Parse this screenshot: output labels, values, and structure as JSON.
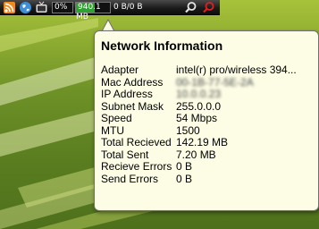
{
  "toolbar": {
    "cpu_percent_label": "0%",
    "cpu_usage_percent": 0,
    "memory_label": "940.1 MB",
    "memory_usage_percent": 55,
    "network_label": "0 B/0 B",
    "icons": [
      "rss-icon",
      "globe-icon",
      "tv-icon",
      "search-icon",
      "search-red-icon"
    ],
    "meter_fill_color": "#2fa32f"
  },
  "flyout": {
    "title": "Network Information",
    "rows": [
      {
        "label": "Adapter",
        "value": "intel(r) pro/wireless 394..."
      },
      {
        "label": "Mac Address",
        "value": "00-1B-77-5E-2A",
        "obscured": true
      },
      {
        "label": "IP Address",
        "value": "10.0.0.23",
        "obscured": true
      },
      {
        "label": "Subnet Mask",
        "value": "255.0.0.0"
      },
      {
        "label": "Speed",
        "value": "54 Mbps"
      },
      {
        "label": "MTU",
        "value": "1500"
      },
      {
        "label": "Total Recieved",
        "value": "142.19 MB"
      },
      {
        "label": "Total Sent",
        "value": "7.20 MB"
      },
      {
        "label": "Recieve Errors",
        "value": "0 B"
      },
      {
        "label": "Send Errors",
        "value": "0 B"
      }
    ],
    "background_color": "#fdfde6"
  }
}
